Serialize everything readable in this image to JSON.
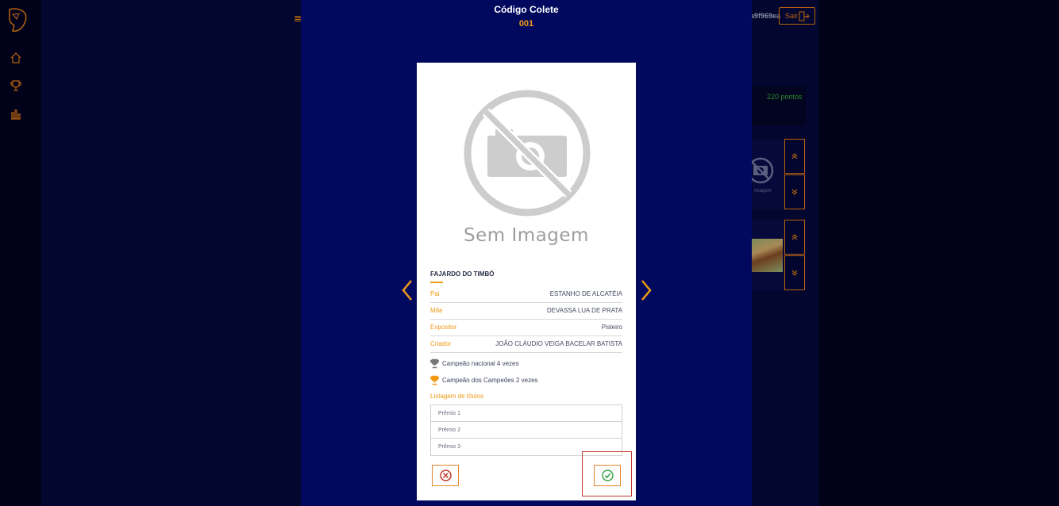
{
  "background": {
    "user_text": "a9f969ea",
    "logout_label": "Sair",
    "points_text": "220 pontos",
    "thumb_caption": "Imagem"
  },
  "modal": {
    "title": "Código Colete",
    "code": "001",
    "placeholder_text": "Sem Imagem",
    "horse_name": "FAJARDO DO TIMBÓ",
    "details": [
      {
        "label": "Pai",
        "value": "ESTANHO DE ALCATÉIA"
      },
      {
        "label": "Mãe",
        "value": "DEVASSA LUA DE PRATA"
      },
      {
        "label": "Expositor",
        "value": "Pisleiro"
      },
      {
        "label": "Criador",
        "value": "JOÃO CLÁUDIO VEIGA BACELAR BATISTA"
      }
    ],
    "titles": [
      {
        "text": "Campeão nacional 4 vezes",
        "icon": "trophy-silver-icon",
        "color": "#777777"
      },
      {
        "text": "Campeão dos Campeões 2 vezes",
        "icon": "trophy-gold-icon",
        "color": "#f09a16"
      }
    ],
    "list_heading": "Listagem de títulos",
    "prizes": [
      "Prêmio 1",
      "Prêmio 2",
      "Prêmio 3"
    ]
  },
  "colors": {
    "accent": "#f09a16",
    "modal_bg": "#00095e",
    "confirm": "#3aa346",
    "reject": "#c0392b"
  }
}
